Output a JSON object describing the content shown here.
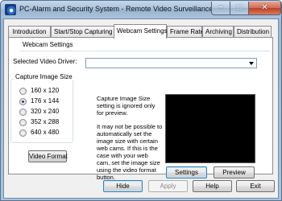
{
  "window": {
    "title": "PC-Alarm and Security System - Remote Video Surveillance",
    "minimize_glyph": "–",
    "maximize_glyph": "□",
    "close_glyph": "✕"
  },
  "tabs": [
    {
      "label": "Introduction",
      "active": false
    },
    {
      "label": "Start/Stop Capturing",
      "active": false
    },
    {
      "label": "Webcam Settings",
      "active": true
    },
    {
      "label": "Frame Rate",
      "active": false
    },
    {
      "label": "Archiving",
      "active": false
    },
    {
      "label": "Distribution",
      "active": false
    }
  ],
  "webcam": {
    "section_title": "Webcam Settings",
    "driver_label": "Selected Video Driver:",
    "driver_value": "",
    "capture_group_title": "Capture Image Size",
    "sizes": [
      {
        "label": "160 x 120",
        "checked": false
      },
      {
        "label": "176 x 144",
        "checked": true
      },
      {
        "label": "320 x 240",
        "checked": false
      },
      {
        "label": "352 x 288",
        "checked": false
      },
      {
        "label": "640 x 480",
        "checked": false
      }
    ],
    "video_format_button": "Video Format",
    "note_line1": "Capture Image Size setting is ignored only for preview.",
    "note_line2": "It may not be possible to automatically set the image size with certain web cams.  If this is the case with your web cam, set the image size using the video format button.",
    "settings_button": "Settings",
    "preview_button": "Preview"
  },
  "footer": {
    "hide": "Hide",
    "apply": "Apply",
    "help": "Help",
    "exit": "Exit"
  },
  "colors": {
    "title_bar": "#a6c0da",
    "close_button": "#c94a2e",
    "preview_area": "#000000"
  }
}
